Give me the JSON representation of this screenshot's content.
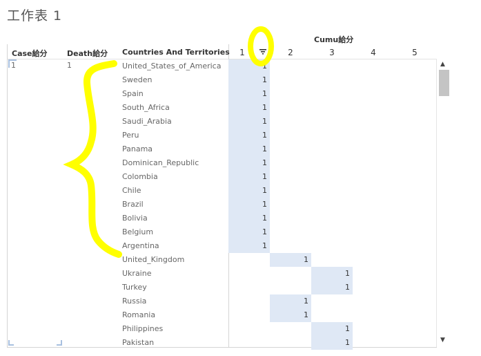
{
  "sheet": {
    "title": "工作表 1"
  },
  "columns": {
    "case": "Case給分",
    "death": "Death給分",
    "countries": "Countries And Territories",
    "cumu_title": "Cumu給分",
    "cumu": [
      "1",
      "2",
      "3",
      "4",
      "5"
    ]
  },
  "case_value": "1",
  "death_value": "1",
  "rows": [
    {
      "country": "United_States_of_America",
      "cumu_col": 1,
      "value": "1"
    },
    {
      "country": "Sweden",
      "cumu_col": 1,
      "value": "1"
    },
    {
      "country": "Spain",
      "cumu_col": 1,
      "value": "1"
    },
    {
      "country": "South_Africa",
      "cumu_col": 1,
      "value": "1"
    },
    {
      "country": "Saudi_Arabia",
      "cumu_col": 1,
      "value": "1"
    },
    {
      "country": "Peru",
      "cumu_col": 1,
      "value": "1"
    },
    {
      "country": "Panama",
      "cumu_col": 1,
      "value": "1"
    },
    {
      "country": "Dominican_Republic",
      "cumu_col": 1,
      "value": "1"
    },
    {
      "country": "Colombia",
      "cumu_col": 1,
      "value": "1"
    },
    {
      "country": "Chile",
      "cumu_col": 1,
      "value": "1"
    },
    {
      "country": "Brazil",
      "cumu_col": 1,
      "value": "1"
    },
    {
      "country": "Bolivia",
      "cumu_col": 1,
      "value": "1"
    },
    {
      "country": "Belgium",
      "cumu_col": 1,
      "value": "1"
    },
    {
      "country": "Argentina",
      "cumu_col": 1,
      "value": "1"
    },
    {
      "country": "United_Kingdom",
      "cumu_col": 2,
      "value": "1"
    },
    {
      "country": "Ukraine",
      "cumu_col": 3,
      "value": "1"
    },
    {
      "country": "Turkey",
      "cumu_col": 3,
      "value": "1"
    },
    {
      "country": "Russia",
      "cumu_col": 2,
      "value": "1"
    },
    {
      "country": "Romania",
      "cumu_col": 2,
      "value": "1"
    },
    {
      "country": "Philippines",
      "cumu_col": 3,
      "value": "1"
    },
    {
      "country": "Pakistan",
      "cumu_col": 3,
      "value": "1"
    }
  ],
  "icons": {
    "sort": "sort-descending-icon",
    "scroll_up": "scroll-up-icon",
    "scroll_down": "scroll-down-icon"
  },
  "colors": {
    "highlight_cell": "#dfe8f5",
    "annotation": "#ffff00"
  }
}
